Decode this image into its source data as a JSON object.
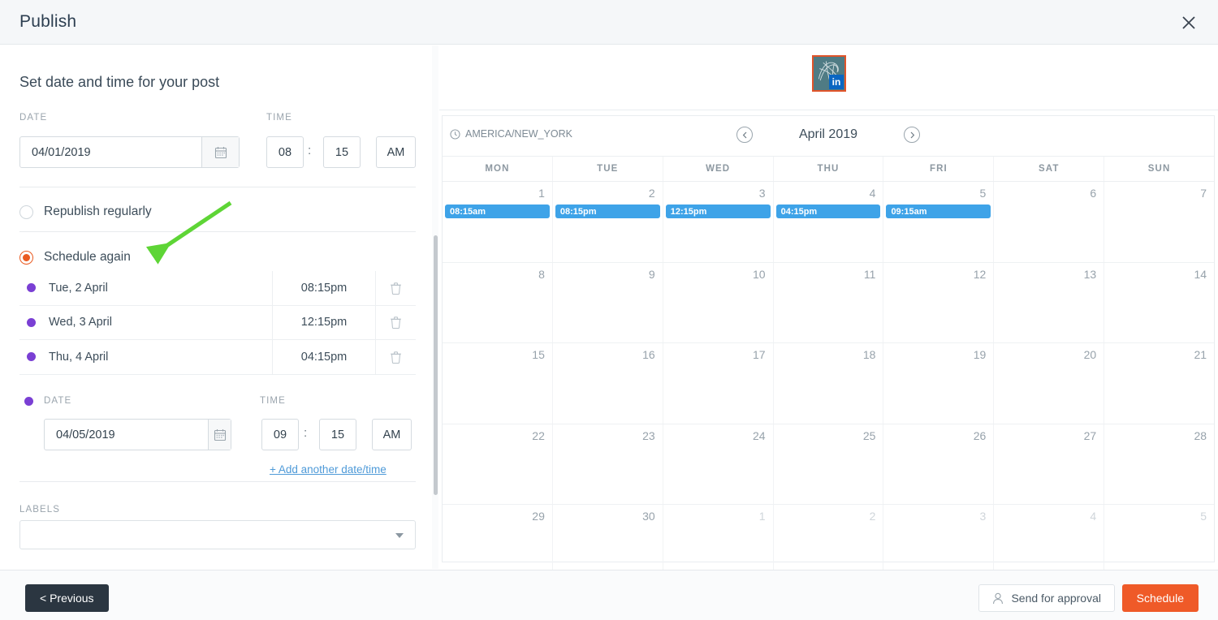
{
  "header": {
    "title": "Publish",
    "close_icon": "close-icon"
  },
  "left": {
    "section_title": "Set date and time for your post",
    "date_label": "DATE",
    "time_label": "TIME",
    "date_value": "04/01/2019",
    "time_hour": "08",
    "time_separator": ":",
    "time_minute": "15",
    "time_meridiem": "AM",
    "calendar_icon": "calendar-icon",
    "options": [
      {
        "label": "Republish regularly",
        "checked": false
      },
      {
        "label": "Schedule again",
        "checked": true
      }
    ],
    "schedule_rows": [
      {
        "day": "Tue, 2 April",
        "time": "08:15pm",
        "delete_icon": "trash-icon"
      },
      {
        "day": "Wed, 3 April",
        "time": "12:15pm",
        "delete_icon": "trash-icon"
      },
      {
        "day": "Thu, 4 April",
        "time": "04:15pm",
        "delete_icon": "trash-icon"
      }
    ],
    "second_entry": {
      "date_label": "DATE",
      "time_label": "TIME",
      "date_value": "04/05/2019",
      "time_hour": "09",
      "time_separator": ":",
      "time_minute": "15",
      "time_meridiem": "AM"
    },
    "add_another_link": "+ Add another date/time",
    "labels_label": "LABELS",
    "labels_value": "",
    "dropdown_icon": "chevron-down-icon"
  },
  "right": {
    "avatar": {
      "network_icon": "linkedin-icon",
      "badge_text": "in"
    },
    "timezone": "AMERICA/NEW_YORK",
    "timezone_icon": "clock-icon",
    "prev_icon": "chevron-left-circle-icon",
    "next_icon": "chevron-right-circle-icon",
    "month": "April 2019",
    "weekdays": [
      "MON",
      "TUE",
      "WED",
      "THU",
      "FRI",
      "SAT",
      "SUN"
    ],
    "weeks": [
      [
        {
          "num": "1",
          "muted": false,
          "event": "08:15am"
        },
        {
          "num": "2",
          "muted": false,
          "event": "08:15pm"
        },
        {
          "num": "3",
          "muted": false,
          "event": "12:15pm"
        },
        {
          "num": "4",
          "muted": false,
          "event": "04:15pm"
        },
        {
          "num": "5",
          "muted": false,
          "event": "09:15am"
        },
        {
          "num": "6",
          "muted": false,
          "event": null
        },
        {
          "num": "7",
          "muted": false,
          "event": null
        }
      ],
      [
        {
          "num": "8",
          "muted": false,
          "event": null
        },
        {
          "num": "9",
          "muted": false,
          "event": null
        },
        {
          "num": "10",
          "muted": false,
          "event": null
        },
        {
          "num": "11",
          "muted": false,
          "event": null
        },
        {
          "num": "12",
          "muted": false,
          "event": null
        },
        {
          "num": "13",
          "muted": false,
          "event": null
        },
        {
          "num": "14",
          "muted": false,
          "event": null
        }
      ],
      [
        {
          "num": "15",
          "muted": false,
          "event": null
        },
        {
          "num": "16",
          "muted": false,
          "event": null
        },
        {
          "num": "17",
          "muted": false,
          "event": null
        },
        {
          "num": "18",
          "muted": false,
          "event": null
        },
        {
          "num": "19",
          "muted": false,
          "event": null
        },
        {
          "num": "20",
          "muted": false,
          "event": null
        },
        {
          "num": "21",
          "muted": false,
          "event": null
        }
      ],
      [
        {
          "num": "22",
          "muted": false,
          "event": null
        },
        {
          "num": "23",
          "muted": false,
          "event": null
        },
        {
          "num": "24",
          "muted": false,
          "event": null
        },
        {
          "num": "25",
          "muted": false,
          "event": null
        },
        {
          "num": "26",
          "muted": false,
          "event": null
        },
        {
          "num": "27",
          "muted": false,
          "event": null
        },
        {
          "num": "28",
          "muted": false,
          "event": null
        }
      ],
      [
        {
          "num": "29",
          "muted": false,
          "event": null
        },
        {
          "num": "30",
          "muted": false,
          "event": null
        },
        {
          "num": "1",
          "muted": true,
          "event": null
        },
        {
          "num": "2",
          "muted": true,
          "event": null
        },
        {
          "num": "3",
          "muted": true,
          "event": null
        },
        {
          "num": "4",
          "muted": true,
          "event": null
        },
        {
          "num": "5",
          "muted": true,
          "event": null
        }
      ]
    ]
  },
  "footer": {
    "previous_label": "< Previous",
    "send_for_approval_label": "Send for approval",
    "approval_icon": "person-icon",
    "schedule_label": "Schedule"
  },
  "colors": {
    "accent_orange": "#ef5a28",
    "event_blue": "#3ea3e8",
    "purple_dot": "#7a3fd4",
    "dark_button": "#2b3641",
    "annotation_green": "#5ed536"
  }
}
